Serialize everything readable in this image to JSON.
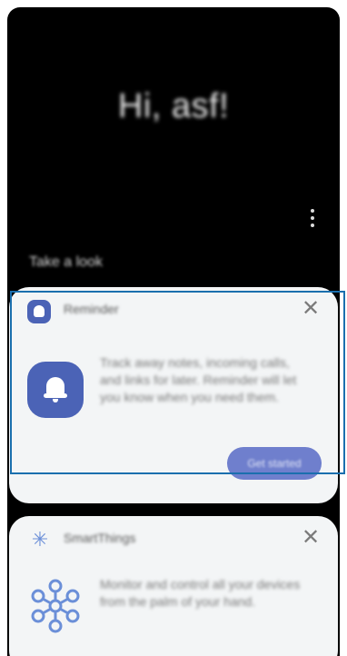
{
  "screen": {
    "greeting": "Hi, asf!",
    "section_title": "Take a look",
    "more_icon": "more-vertical-icon"
  },
  "cards": [
    {
      "name": "Reminder",
      "description": "Track away notes, incoming calls, and links for later. Reminder will let you know when you need them.",
      "action_label": "Get started",
      "icon": "bell-icon",
      "accent": "#4b63b6"
    },
    {
      "name": "SmartThings",
      "description": "Monitor and control all your devices from the palm of your hand.",
      "icon": "smartthings-icon",
      "accent": "#6b8fd8"
    }
  ],
  "colors": {
    "background": "#000000",
    "card": "#f3f5f6",
    "highlight": "#1a6fae",
    "button": "#6f7fcd"
  }
}
